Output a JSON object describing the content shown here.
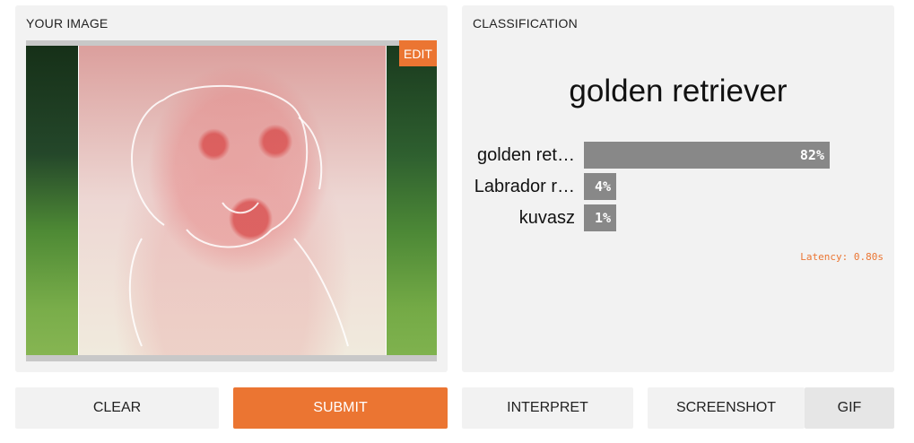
{
  "input_panel": {
    "title": "YOUR IMAGE",
    "edit_label": "EDIT"
  },
  "output_panel": {
    "title": "CLASSIFICATION",
    "top_label": "golden retriever",
    "confidences": [
      {
        "label": "golden ret…",
        "value_text": "82%",
        "fraction": 0.82
      },
      {
        "label": "Labrador r…",
        "value_text": "4%",
        "fraction": 0.04
      },
      {
        "label": "kuvasz",
        "value_text": "1%",
        "fraction": 0.01
      }
    ],
    "latency": "Latency: 0.80s"
  },
  "buttons": {
    "clear": "CLEAR",
    "submit": "SUBMIT",
    "interpret": "INTERPRET",
    "screenshot": "SCREENSHOT",
    "gif": "GIF"
  },
  "colors": {
    "accent": "#eb7532",
    "bar": "#888888",
    "panel": "#f2f2f2"
  }
}
